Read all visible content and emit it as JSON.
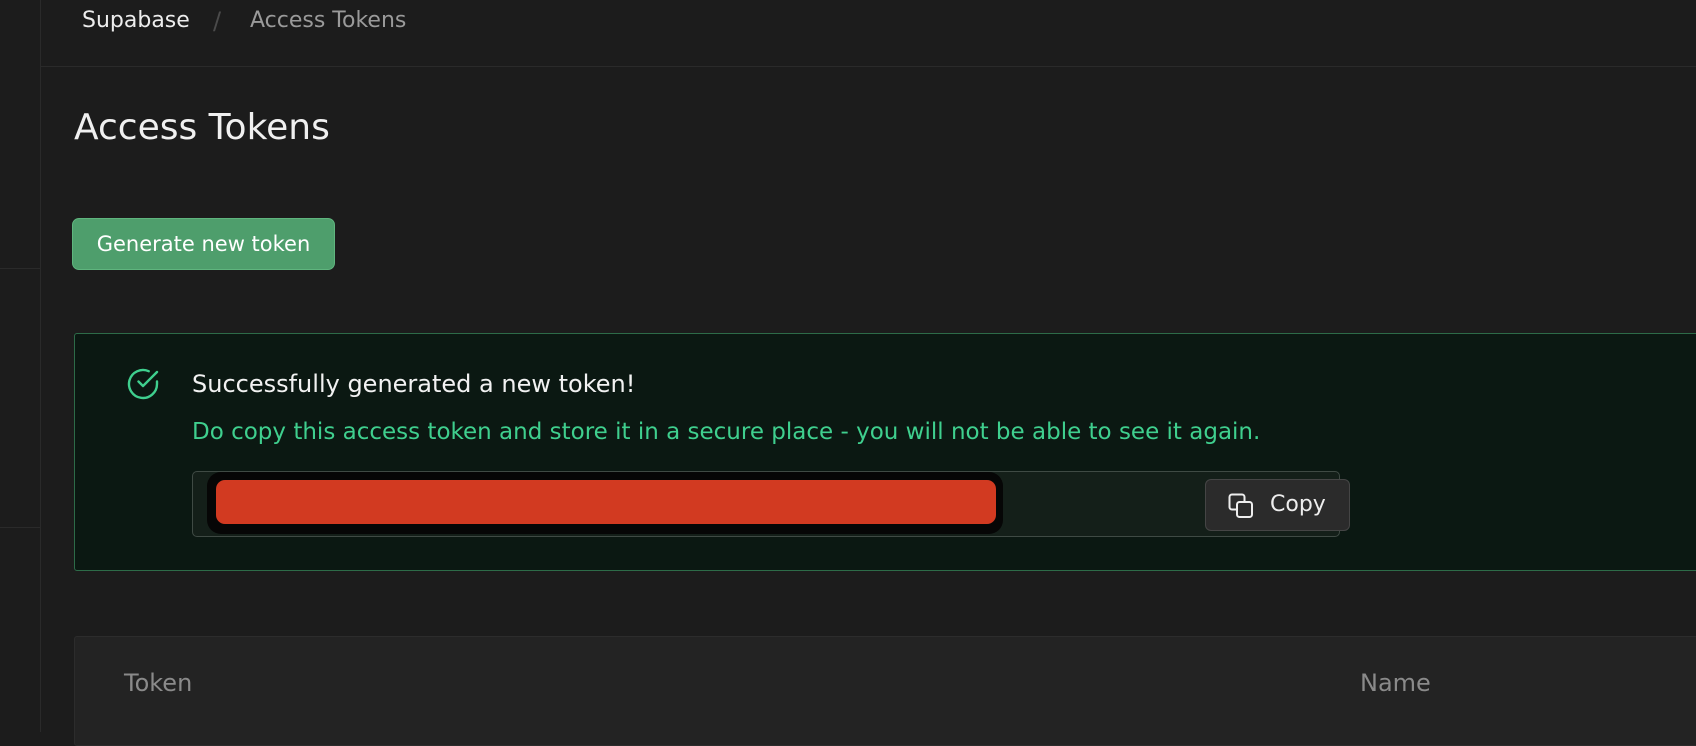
{
  "breadcrumb": {
    "root": "Supabase",
    "separator": "/",
    "current": "Access Tokens"
  },
  "page": {
    "title": "Access Tokens"
  },
  "actions": {
    "generate_label": "Generate new token"
  },
  "alert": {
    "icon": "check-circle-icon",
    "title": "Successfully generated a new token!",
    "description": "Do copy this access token and store it in a secure place - you will not be able to see it again.",
    "token_value_redacted": true,
    "copy_label": "Copy",
    "copy_icon": "copy-icon"
  },
  "table": {
    "columns": [
      "Token",
      "Name"
    ]
  },
  "colors": {
    "accent": "#3fcf8e",
    "button_green": "#4e9e6c",
    "background": "#1c1c1c",
    "redaction": "#d23a21"
  }
}
